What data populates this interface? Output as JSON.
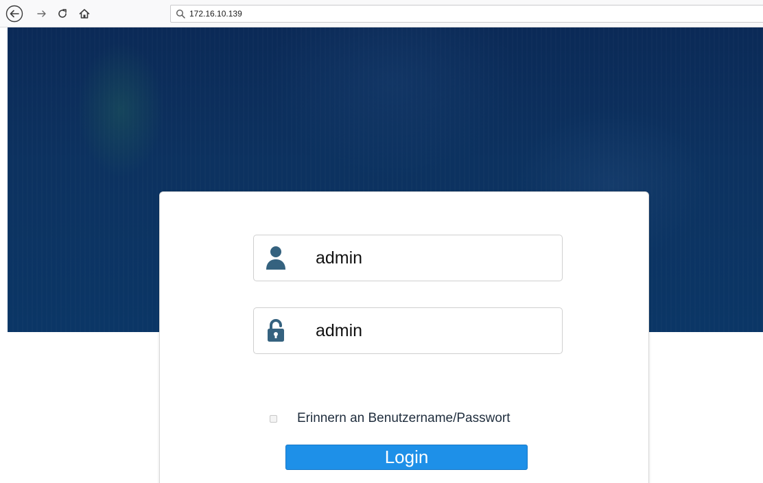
{
  "browser": {
    "url": "172.16.10.139",
    "icons": {
      "back": "back-arrow-icon",
      "forward": "forward-arrow-icon",
      "reload": "reload-icon",
      "home": "home-icon",
      "url_search": "search-icon"
    }
  },
  "login": {
    "username_value": "admin",
    "password_value": "admin",
    "remember_label": "Erinnern an Benutzername/Passwort",
    "remember_checked": false,
    "login_button": "Login",
    "icons": {
      "username": "user-icon",
      "password": "unlock-icon"
    }
  },
  "colors": {
    "hero_background": "#0c3260",
    "login_button": "#1e90e8",
    "field_icon": "#35627f"
  }
}
